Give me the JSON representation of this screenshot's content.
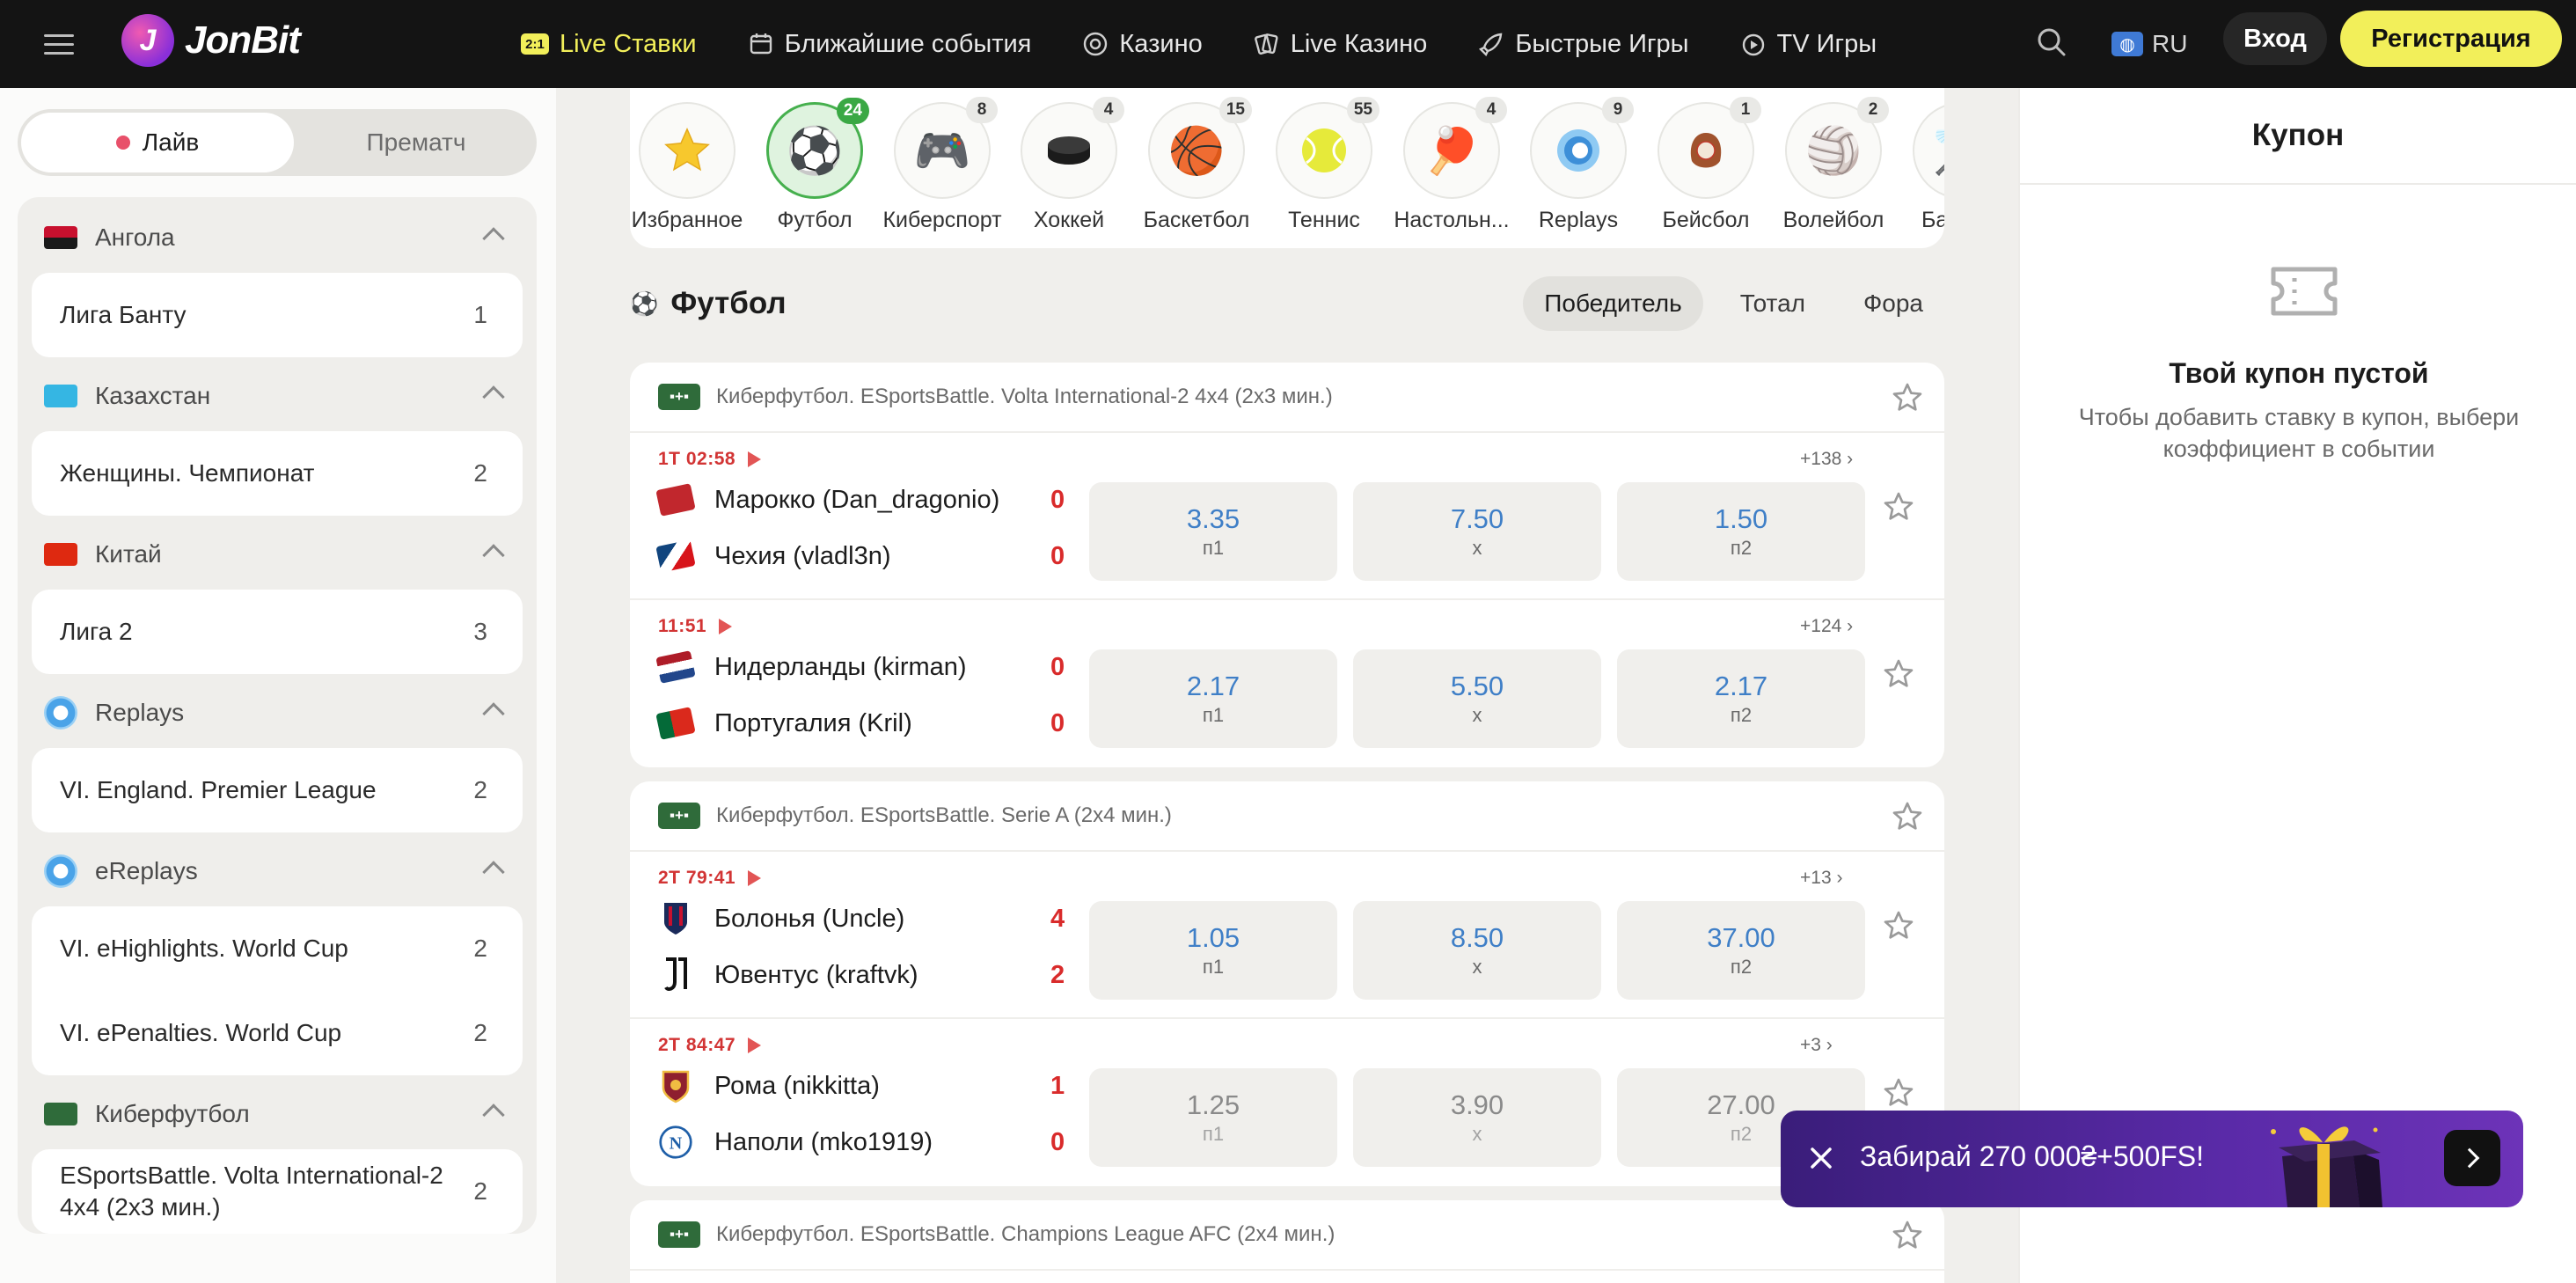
{
  "header": {
    "logo": "JonBit",
    "logo_mark": "J",
    "nav": [
      {
        "label": "Live Ставки",
        "icon": "live-badge-icon",
        "badge": "2:1"
      },
      {
        "label": "Ближайшие события",
        "icon": "calendar-icon"
      },
      {
        "label": "Казино",
        "icon": "casino-chip-icon"
      },
      {
        "label": "Live Казино",
        "icon": "cards-icon"
      },
      {
        "label": "Быстрые Игры",
        "icon": "rocket-icon"
      },
      {
        "label": "TV Игры",
        "icon": "tv-games-icon"
      }
    ],
    "lang": "RU",
    "login": "Вход",
    "register": "Регистрация"
  },
  "sidebar": {
    "toggle_live": "Лайв",
    "toggle_prematch": "Прематч",
    "groups": [
      {
        "country": "Ангола",
        "leagues": [
          {
            "name": "Лига Банту",
            "count": "1"
          }
        ]
      },
      {
        "country": "Казахстан",
        "leagues": [
          {
            "name": "Женщины. Чемпионат",
            "count": "2"
          }
        ]
      },
      {
        "country": "Китай",
        "leagues": [
          {
            "name": "Лига 2",
            "count": "3"
          }
        ]
      },
      {
        "country": "Replays",
        "leagues": [
          {
            "name": "VI. England. Premier League",
            "count": "2"
          }
        ]
      },
      {
        "country": "eReplays",
        "leagues": [
          {
            "name": "VI. eHighlights. World Cup",
            "count": "2"
          },
          {
            "name": "VI. ePenalties. World Cup",
            "count": "2"
          }
        ]
      },
      {
        "country": "Киберфутбол",
        "leagues": [
          {
            "name": "ESportsBattle. Volta International-2 4x4 (2x3 мин.)",
            "count": "2"
          }
        ]
      }
    ]
  },
  "sports": [
    {
      "label": "Избранное",
      "icon": "star-icon",
      "count": ""
    },
    {
      "label": "Футбол",
      "icon": "soccer-ball-icon",
      "count": "24"
    },
    {
      "label": "Киберспорт",
      "icon": "gamepad-icon",
      "count": "8"
    },
    {
      "label": "Хоккей",
      "icon": "hockey-puck-icon",
      "count": "4"
    },
    {
      "label": "Баскетбол",
      "icon": "basketball-icon",
      "count": "15"
    },
    {
      "label": "Теннис",
      "icon": "tennis-ball-icon",
      "count": "55"
    },
    {
      "label": "Настольн...",
      "icon": "table-tennis-icon",
      "count": "4"
    },
    {
      "label": "Replays",
      "icon": "replays-icon",
      "count": "9"
    },
    {
      "label": "Бейсбол",
      "icon": "baseball-glove-icon",
      "count": "1"
    },
    {
      "label": "Волейбол",
      "icon": "volleyball-icon",
      "count": "2"
    },
    {
      "label": "Бад",
      "icon": "badminton-icon",
      "count": ""
    }
  ],
  "section": {
    "title": "Футбол",
    "tabs": [
      "Победитель",
      "Тотал",
      "Фора"
    ]
  },
  "cards": [
    {
      "title": "Киберфутбол. ESportsBattle. Volta International-2 4x4 (2x3 мин.)",
      "badge": "▪+▪",
      "matches": [
        {
          "time": "1T 02:58",
          "more": "+138 ›",
          "team1": "Марокко (Dan_dragonio)",
          "score1": "0",
          "team2": "Чехия (vladl3n)",
          "score2": "0",
          "odds": [
            {
              "v": "3.35",
              "l": "п1"
            },
            {
              "v": "7.50",
              "l": "х"
            },
            {
              "v": "1.50",
              "l": "п2"
            }
          ]
        },
        {
          "time": "11:51",
          "more": "+124 ›",
          "team1": "Нидерланды (kirman)",
          "score1": "0",
          "team2": "Португалия (Kril)",
          "score2": "0",
          "odds": [
            {
              "v": "2.17",
              "l": "п1"
            },
            {
              "v": "5.50",
              "l": "х"
            },
            {
              "v": "2.17",
              "l": "п2"
            }
          ]
        }
      ]
    },
    {
      "title": "Киберфутбол. ESportsBattle. Serie A (2x4 мин.)",
      "badge": "▪+▪",
      "matches": [
        {
          "time": "2T 79:41",
          "more": "+13 ›",
          "team1": "Болонья (Uncle)",
          "score1": "4",
          "team2": "Ювентус (kraftvk)",
          "score2": "2",
          "odds": [
            {
              "v": "1.05",
              "l": "п1"
            },
            {
              "v": "8.50",
              "l": "х"
            },
            {
              "v": "37.00",
              "l": "п2"
            }
          ]
        },
        {
          "time": "2T 84:47",
          "more": "+3 ›",
          "team1": "Рома (nikkitta)",
          "score1": "1",
          "team2": "Наполи (mko1919)",
          "score2": "0",
          "odds": [
            {
              "v": "1.25",
              "l": "п1"
            },
            {
              "v": "3.90",
              "l": "х"
            },
            {
              "v": "27.00",
              "l": "п2"
            }
          ]
        }
      ]
    },
    {
      "title": "Киберфутбол. ESportsBattle. Champions League AFC (2x4 мин.)",
      "badge": "▪+▪",
      "matches": []
    }
  ],
  "coupon": {
    "title": "Купон",
    "empty_title": "Твой купон пустой",
    "empty_hint": "Чтобы добавить ставку в купон, выбери коэффициент в событии"
  },
  "promo": {
    "text": "Забирай 270 000₴+500FS!"
  },
  "colors": {
    "accent": "#f2ef5a",
    "header_bg": "#141414",
    "odds_blue": "#3f7fc7",
    "live_red": "#d23434",
    "active_green": "#3aa844",
    "promo_purple": "#5a2aa8"
  }
}
